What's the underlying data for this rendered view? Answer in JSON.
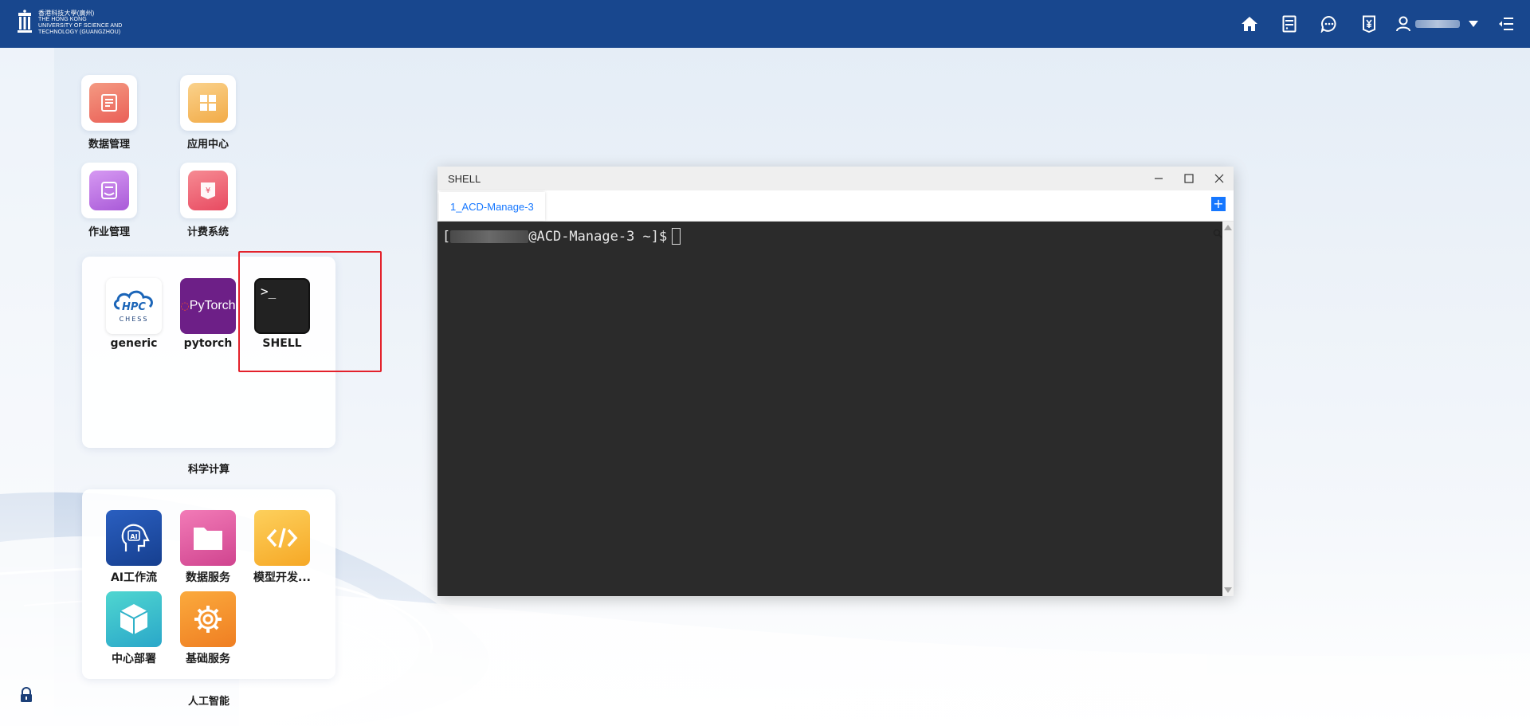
{
  "logo": {
    "line1": "香港科技大學(廣州)",
    "line2": "THE HONG KONG",
    "line3": "UNIVERSITY OF SCIENCE AND",
    "line4": "TECHNOLOGY (GUANGZHOU)"
  },
  "topbar": {
    "icons": [
      "home-icon",
      "server-icon",
      "message-icon",
      "billing-icon",
      "user-icon",
      "menu-icon"
    ]
  },
  "desktop": {
    "apps": [
      {
        "label": "数据管理",
        "icon": "data-management-icon",
        "color": "#f07a6b"
      },
      {
        "label": "应用中心",
        "icon": "app-center-icon",
        "color": "#f7c46b"
      },
      {
        "label": "作业管理",
        "icon": "job-management-icon",
        "color": "#c77ee8"
      },
      {
        "label": "计费系统",
        "icon": "billing-system-icon",
        "color": "#f26b7a"
      }
    ]
  },
  "science_group": {
    "title": "科学计算",
    "apps": [
      {
        "label": "generic",
        "tile_text": "CHESS"
      },
      {
        "label": "pytorch",
        "tile_text": "PyTorch"
      },
      {
        "label": "SHELL",
        "tile_text": ">_"
      }
    ]
  },
  "ai_group": {
    "title": "人工智能",
    "apps": [
      {
        "label": "AI工作流",
        "tile_text": "AI"
      },
      {
        "label": "数据服务"
      },
      {
        "label": "模型开发..."
      },
      {
        "label": "中心部署"
      },
      {
        "label": "基础服务"
      }
    ]
  },
  "shell_window": {
    "title": "SHELL",
    "tab_label": "1_ACD-Manage-3",
    "add_tab": "+",
    "prompt_open": "[",
    "prompt_rest": "@ACD-Manage-3 ~]$"
  }
}
